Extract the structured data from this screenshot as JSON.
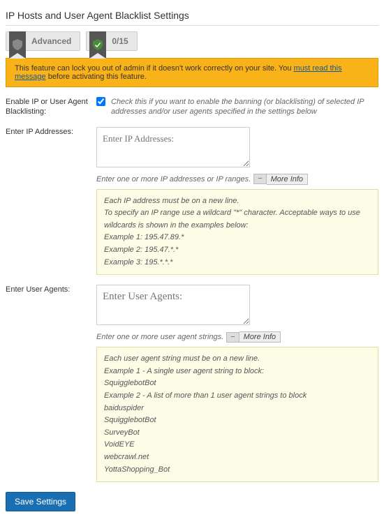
{
  "title": "IP Hosts and User Agent Blacklist Settings",
  "badges": {
    "advanced": "Advanced",
    "score": "0/15"
  },
  "warning": {
    "prefix": "This feature can lock you out of admin if it doesn't work correctly on your site. You ",
    "link": "must read this message",
    "suffix": " before activating this feature."
  },
  "enable": {
    "label": "Enable IP or User Agent Blacklisting:",
    "helper": "Check this if you want to enable the banning (or blacklisting) of selected IP addresses and/or user agents specified in the settings below"
  },
  "ip": {
    "label": "Enter IP Addresses:",
    "placeholder": "Enter IP Addresses:",
    "hint": "Enter one or more IP addresses or IP ranges.",
    "more": "More Info",
    "info": [
      "Each IP address must be on a new line.",
      "To specify an IP range use a wildcard \"*\" character. Acceptable ways to use wildcards is shown in the examples below:",
      "Example 1: 195.47.89.*",
      "Example 2: 195.47.*.*",
      "Example 3: 195.*.*.*"
    ]
  },
  "ua": {
    "label": "Enter User Agents:",
    "placeholder": "Enter User Agents:",
    "hint": "Enter one or more user agent strings.",
    "more": "More Info",
    "info": [
      "Each user agent string must be on a new line.",
      "Example 1 - A single user agent string to block:",
      "SquigglebotBot",
      "Example 2 - A list of more than 1 user agent strings to block",
      "baiduspider",
      "SquigglebotBot",
      "SurveyBot",
      "VoidEYE",
      "webcrawl.net",
      "YottaShopping_Bot"
    ]
  },
  "save": "Save Settings"
}
